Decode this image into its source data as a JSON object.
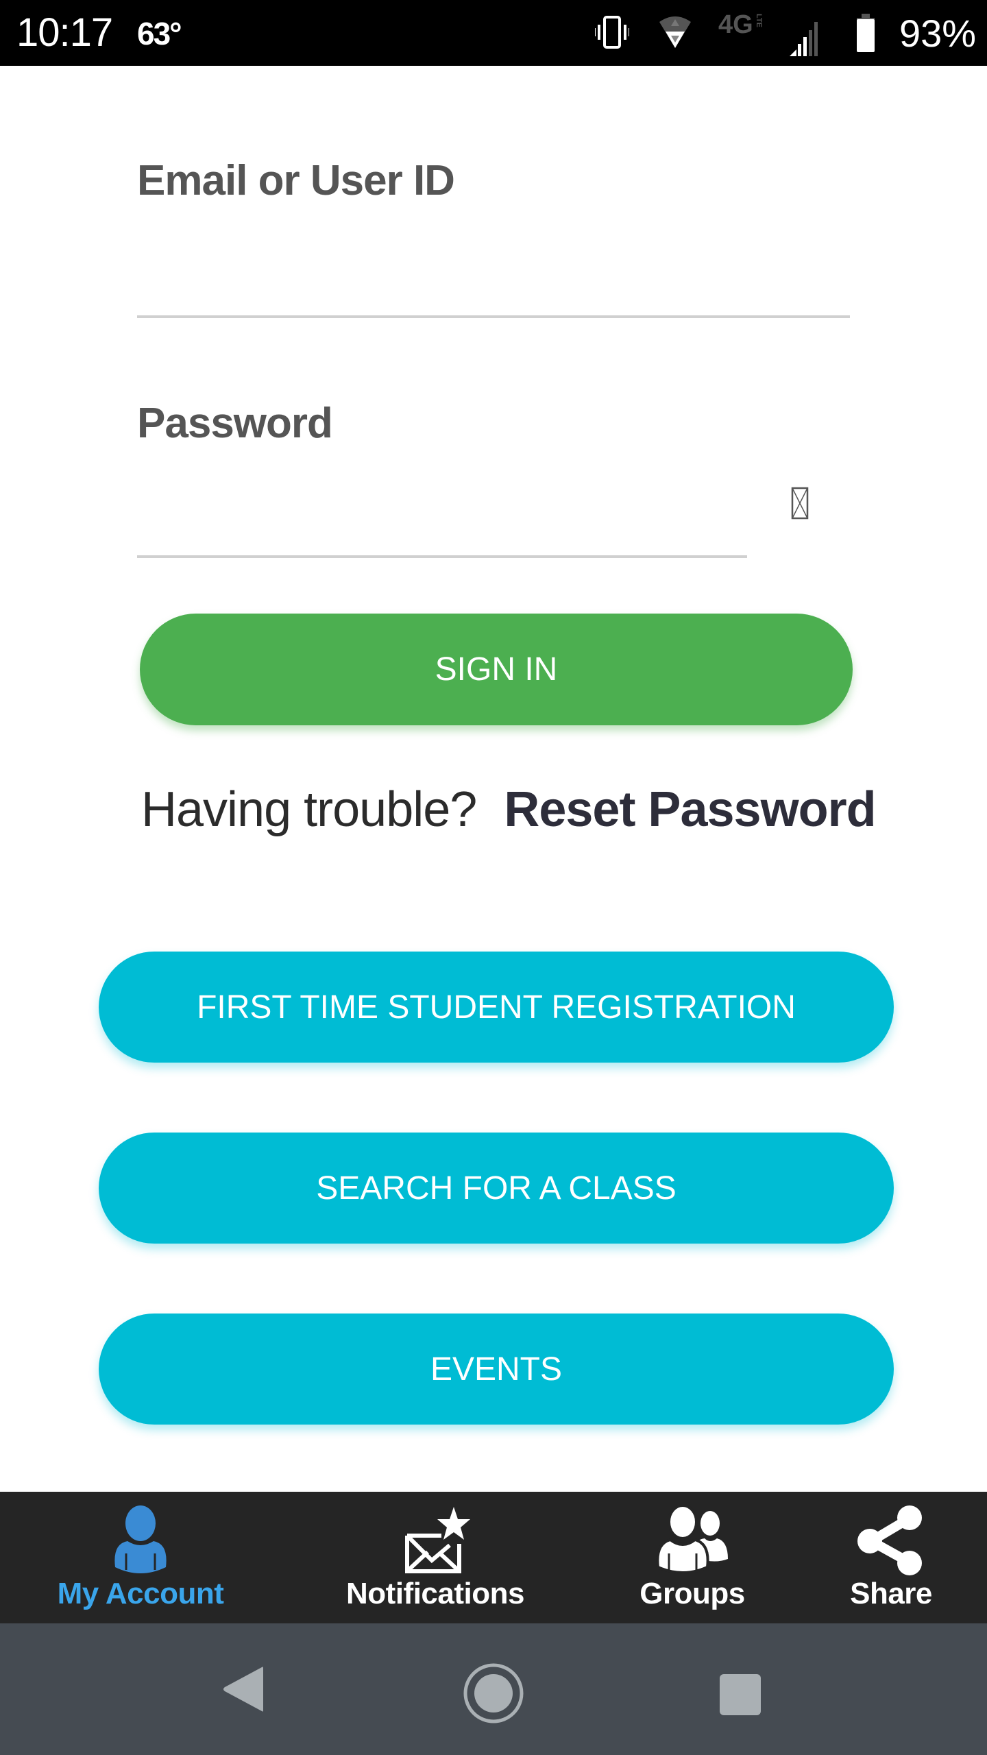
{
  "status_bar": {
    "time": "10:17",
    "temperature": "63°",
    "network": "4G LTE",
    "battery": "93%",
    "icons": [
      "vibrate-icon",
      "wifi-icon",
      "4g-lte-icon",
      "signal-icon",
      "battery-icon"
    ]
  },
  "login_form": {
    "email_label": "Email or User ID",
    "email_value": "",
    "email_placeholder": "",
    "password_label": "Password",
    "password_value": "",
    "password_placeholder": "",
    "password_toggle_icon": "missing-glyph-icon",
    "sign_in_label": "SIGN IN",
    "trouble_text": "Having trouble?",
    "reset_password_label": "Reset Password"
  },
  "actions": [
    {
      "label": "FIRST TIME STUDENT REGISTRATION"
    },
    {
      "label": "SEARCH FOR A CLASS"
    },
    {
      "label": "EVENTS"
    }
  ],
  "bottom_nav": {
    "active": "My Account",
    "items": [
      {
        "label": "My Account",
        "icon": "user-icon"
      },
      {
        "label": "Notifications",
        "icon": "envelope-star-icon"
      },
      {
        "label": "Groups",
        "icon": "users-icon"
      },
      {
        "label": "Share",
        "icon": "share-icon"
      }
    ]
  },
  "system_nav": {
    "buttons": [
      "back",
      "home",
      "recents"
    ]
  },
  "colors": {
    "sign_in": "#4caf50",
    "action_buttons": "#00bcd4",
    "active_tab": "#3aa5eb",
    "bottom_nav_bg": "#252525",
    "system_nav_bg": "#454b52"
  }
}
